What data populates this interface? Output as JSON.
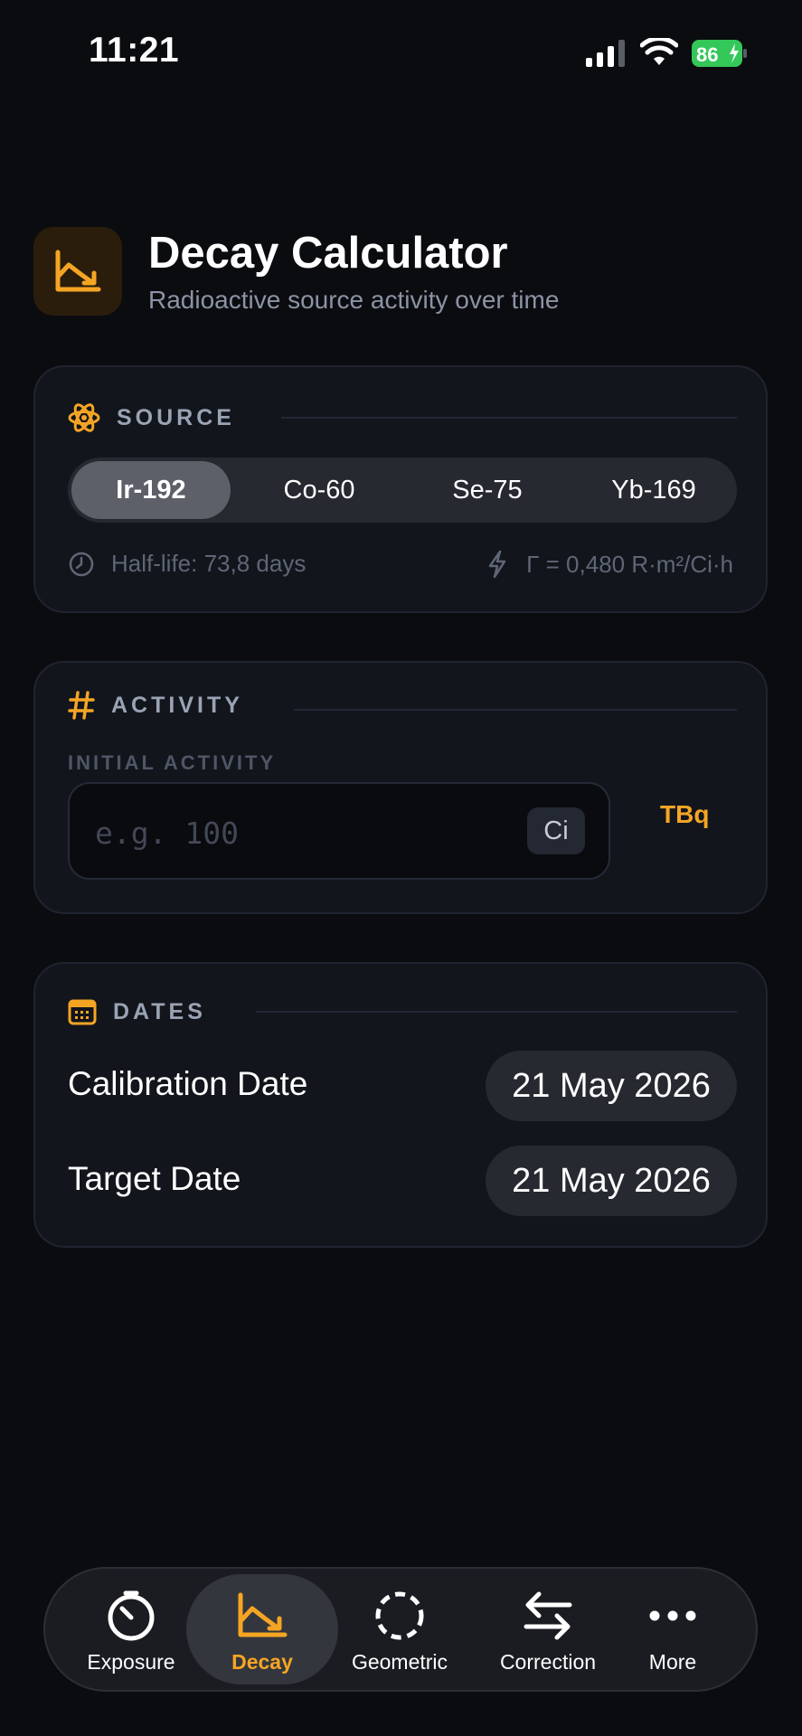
{
  "status_bar": {
    "time": "11:21",
    "battery": "86"
  },
  "header": {
    "title": "Decay Calculator",
    "subtitle": "Radioactive source activity over time",
    "icon": "decay-chart-icon"
  },
  "source": {
    "label": "SOURCE",
    "options": [
      "Ir-192",
      "Co-60",
      "Se-75",
      "Yb-169"
    ],
    "selected": "Ir-192",
    "half_life": "Half-life: 73,8 days",
    "gamma": "Γ = 0,480 R·m²/Ci·h"
  },
  "activity": {
    "label": "ACTIVITY",
    "field_label": "INITIAL ACTIVITY",
    "placeholder": "e.g. 100",
    "unit": "Ci",
    "alt_unit": "TBq"
  },
  "dates": {
    "label": "DATES",
    "calibration_label": "Calibration Date",
    "calibration_value": "21 May 2026",
    "target_label": "Target Date",
    "target_value": "21 May 2026"
  },
  "tabs": [
    {
      "label": "Exposure",
      "icon": "gauge-icon"
    },
    {
      "label": "Decay",
      "icon": "decay-chart-icon",
      "active": true
    },
    {
      "label": "Geometric",
      "icon": "dashed-circle-icon"
    },
    {
      "label": "Correction",
      "icon": "swap-arrows-icon"
    },
    {
      "label": "More",
      "icon": "ellipsis-icon"
    }
  ],
  "colors": {
    "accent": "#f5a524",
    "background": "#0b0c10",
    "card": "#12151c",
    "battery": "#34c759"
  }
}
